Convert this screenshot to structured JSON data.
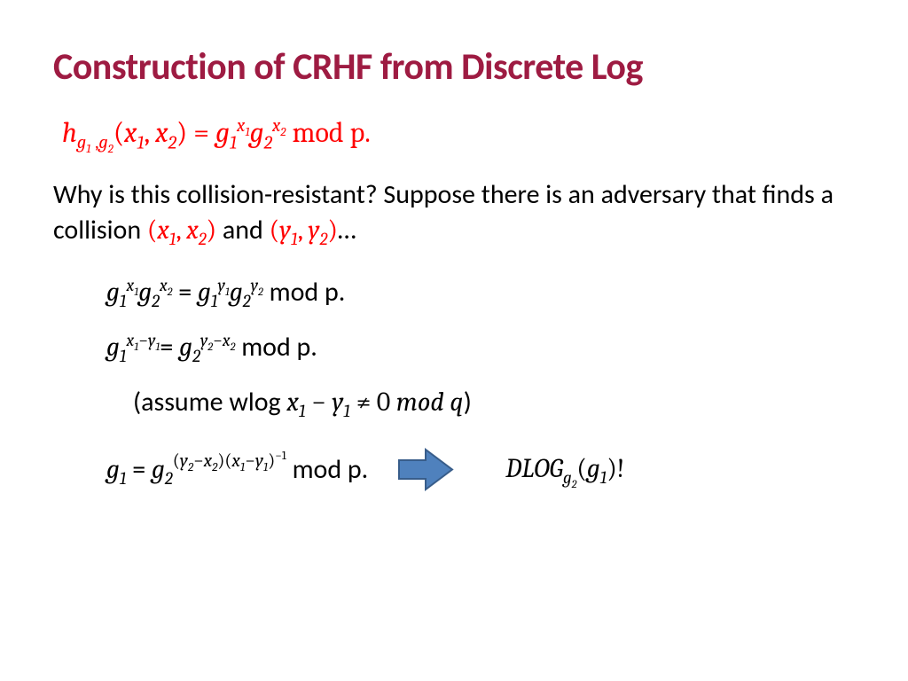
{
  "title": "Construction of CRHF from Discrete Log",
  "hash_def": {
    "lhs_h": "h",
    "sub_g1": "g",
    "sub_g1_idx": "1",
    "sub_comma": " ,",
    "sub_g2": "g",
    "sub_g2_idx": "2",
    "args_open": "(",
    "x1": "x",
    "x1_idx": "1",
    "comma": ", ",
    "x2": "x",
    "x2_idx": "2",
    "args_close": ")",
    "eq": " = ",
    "g1": "g",
    "g1_idx": "1",
    "exp_x1": "x",
    "exp_x1_idx": "1",
    "g2": "g",
    "g2_idx": "2",
    "exp_x2": "x",
    "exp_x2_idx": "2",
    "mod": " mod p."
  },
  "body1a": "Why is this collision-resistant? Suppose there is an adversary that finds a collision ",
  "collision1_open": "(",
  "collision1_x1": "x",
  "collision1_x1_idx": "1",
  "collision1_comma": ", ",
  "collision1_x2": "x",
  "collision1_x2_idx": "2",
  "collision1_close": ")",
  "body1b": " and ",
  "collision2_open": "(",
  "collision2_y1": "y",
  "collision2_y1_idx": "1",
  "collision2_comma": ", ",
  "collision2_y2": "y",
  "collision2_y2_idx": "2",
  "collision2_close": ")",
  "body1c": "…",
  "eq1": {
    "g1": "g",
    "g1_idx": "1",
    "exp_x1": "x",
    "exp_x1_idx": "1",
    "g2": "g",
    "g2_idx": "2",
    "exp_x2": "x",
    "exp_x2_idx": "2",
    "eq": " = ",
    "g1b": "g",
    "g1b_idx": "1",
    "exp_y1": "y",
    "exp_y1_idx": "1",
    "g2b": "g",
    "g2b_idx": "2",
    "exp_y2": "y",
    "exp_y2_idx": "2",
    "mod": " mod p."
  },
  "eq2": {
    "g1": "g",
    "g1_idx": "1",
    "exp1_a": "x",
    "exp1_a_idx": "1",
    "exp1_minus": "−",
    "exp1_b": "y",
    "exp1_b_idx": "1",
    "eq": "= ",
    "g2": "g",
    "g2_idx": "2",
    "exp2_a": "y",
    "exp2_a_idx": "2",
    "exp2_minus": "−",
    "exp2_b": "x",
    "exp2_b_idx": "2",
    "mod": " mod p."
  },
  "assume_a": "(assume wlog ",
  "assume_x1": "x",
  "assume_x1_idx": "1",
  "assume_minus": " − ",
  "assume_y1": "y",
  "assume_y1_idx": "1",
  "assume_neq": " ≠ 0 ",
  "assume_mod": "mod q",
  "assume_close": ")",
  "eq3": {
    "g1": "g",
    "g1_idx": "1",
    "eq": " = ",
    "g2": "g",
    "g2_idx": "2",
    "exp_open": "(",
    "exp_y2": "y",
    "exp_y2_idx": "2",
    "exp_m1": "−",
    "exp_x2": "x",
    "exp_x2_idx": "2",
    "exp_mid": ")(",
    "exp_x1": "x",
    "exp_x1_idx": "1",
    "exp_m2": "−",
    "exp_y1": "y",
    "exp_y1_idx": "1",
    "exp_close": ")",
    "exp_inv": "−1",
    "mod": " mod p."
  },
  "dlog": {
    "name": "DLOG",
    "sub_g": "g",
    "sub_g_idx": "2",
    "open": "(",
    "arg_g": "g",
    "arg_g_idx": "1",
    "close": ")!",
    "space": ""
  },
  "arrow_color_fill": "#4f81bd",
  "arrow_color_stroke": "#385d8a"
}
